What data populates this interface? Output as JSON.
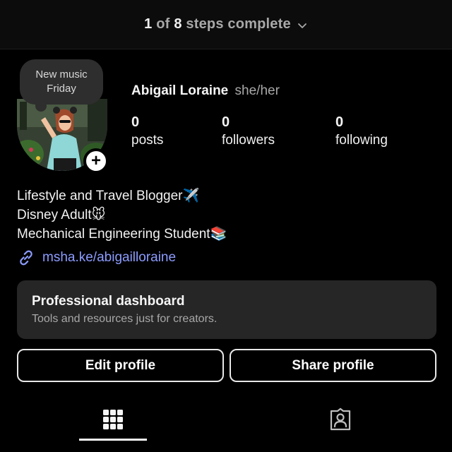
{
  "header": {
    "steps_done": "1",
    "steps_of": "of",
    "steps_total": "8",
    "steps_label": "steps complete",
    "chevron": "chevron-down-icon"
  },
  "profile": {
    "note": "New music Friday",
    "name": "Abigail Loraine",
    "pronouns": "she/her",
    "add_story_icon": "plus-icon",
    "stats": [
      {
        "count": "0",
        "label": "posts"
      },
      {
        "count": "0",
        "label": "followers"
      },
      {
        "count": "0",
        "label": "following"
      }
    ]
  },
  "bio": {
    "lines": [
      {
        "text": "Lifestyle and Travel Blogger",
        "emoji": "✈️"
      },
      {
        "text": "Disney Adult",
        "emoji": "🐭"
      },
      {
        "text": "Mechanical Engineering Student",
        "emoji": "📚"
      }
    ],
    "link": "msha.ke/abigailloraine",
    "link_icon": "link-icon"
  },
  "dashboard": {
    "title": "Professional dashboard",
    "subtitle": "Tools and resources just for creators."
  },
  "actions": {
    "edit": "Edit profile",
    "share": "Share profile"
  },
  "tabs": [
    {
      "icon": "grid-icon",
      "active": true
    },
    {
      "icon": "tagged-icon",
      "active": false
    }
  ],
  "colors": {
    "background": "#000000",
    "link": "#8c9cff",
    "card": "#262626",
    "muted": "#a8a8a8"
  }
}
